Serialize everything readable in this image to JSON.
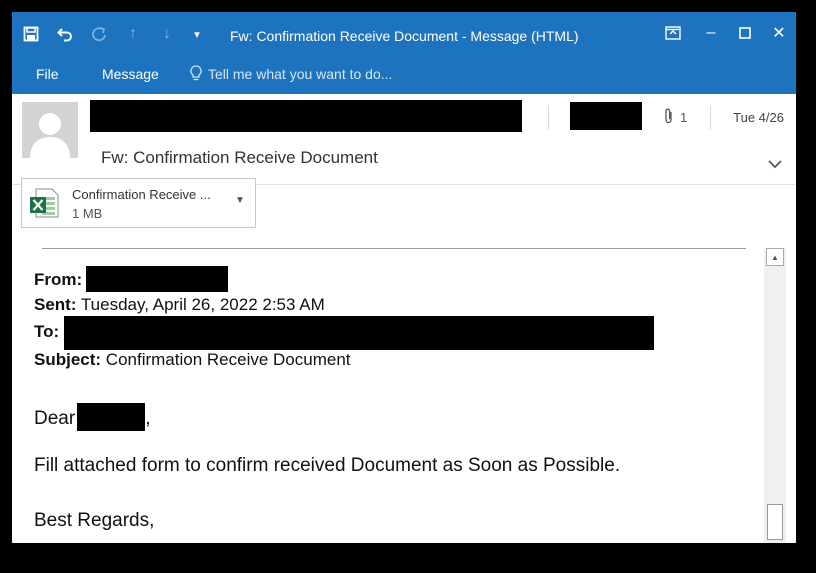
{
  "window": {
    "title": "Fw: Confirmation Receive Document - Message (HTML)",
    "controls": {
      "ribbon_display": "▣",
      "minimize": "–",
      "maximize": "☐",
      "close": "✕"
    }
  },
  "quick_access": {
    "save_icon": "save-icon",
    "undo_icon": "undo-icon",
    "redo_icon": "redo-icon",
    "up_icon": "up-arrow-icon",
    "down_icon": "down-arrow-icon",
    "customize_icon": "customize-icon"
  },
  "ribbon": {
    "tabs": [
      {
        "label": "File"
      },
      {
        "label": "Message"
      }
    ],
    "tell_me": "Tell me what you want to do..."
  },
  "header": {
    "subject": "Fw: Confirmation Receive Document",
    "attachment_count": "1",
    "date": "Tue 4/26"
  },
  "attachment": {
    "name": "Confirmation Receive ...",
    "size": "1 MB"
  },
  "message": {
    "from_label": "From:",
    "sent_label": "Sent:",
    "sent_value": "Tuesday, April 26, 2022 2:53 AM",
    "to_label": "To:",
    "subject_label": "Subject:",
    "subject_value": "Confirmation Receive Document",
    "greeting": "Dear",
    "greeting_suffix": ",",
    "body": "Fill attached form to confirm received Document as Soon as Possible.",
    "closing": "Best Regards,"
  },
  "colors": {
    "titlebar": "#1e73be",
    "redaction": "#000000"
  }
}
